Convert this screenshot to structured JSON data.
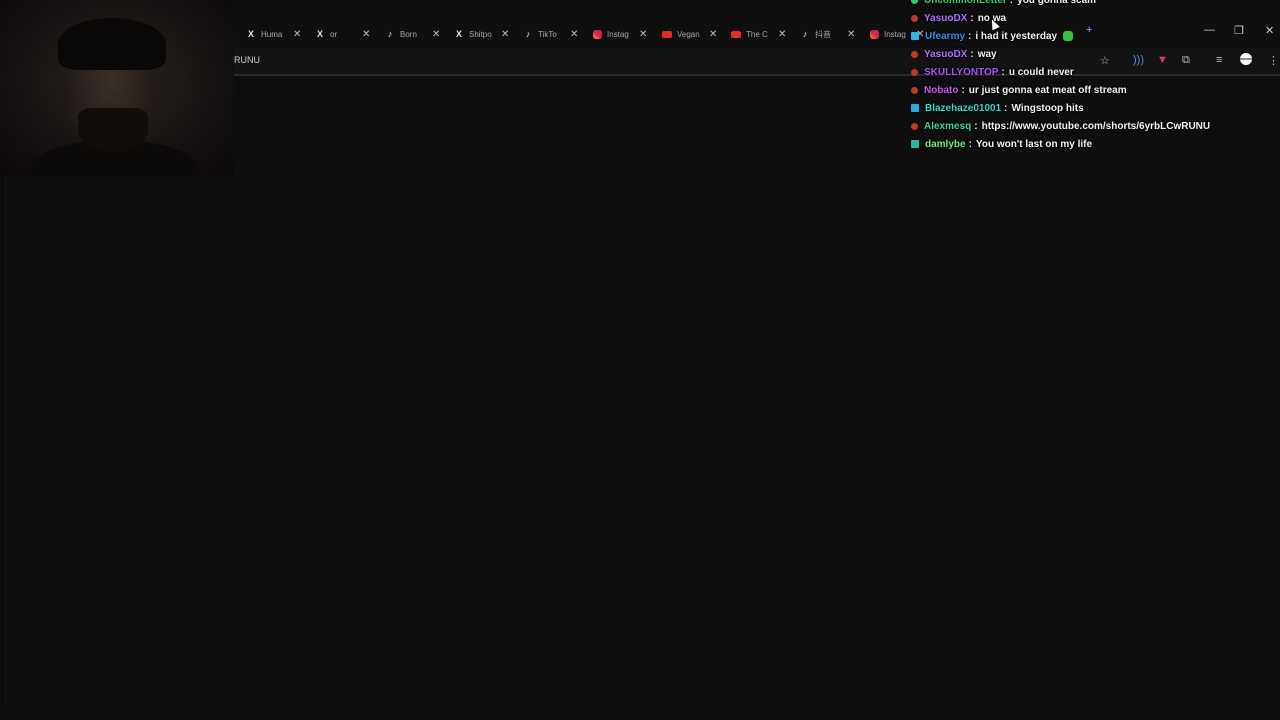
{
  "browser": {
    "tabs": [
      {
        "icon": "x-logo-icon",
        "label": "Huma"
      },
      {
        "icon": "x-logo-icon",
        "label": "or"
      },
      {
        "icon": "tiktok-icon",
        "label": "Born"
      },
      {
        "icon": "x-logo-icon",
        "label": "Shitpo"
      },
      {
        "icon": "tiktok-icon",
        "label": "TikTo"
      },
      {
        "icon": "instagram-icon",
        "label": "Instag"
      },
      {
        "icon": "youtube-icon",
        "label": "Vegan"
      },
      {
        "icon": "youtube-icon",
        "label": "The C"
      },
      {
        "icon": "tiktok-icon",
        "label": "抖音"
      },
      {
        "icon": "instagram-icon",
        "label": "Instag"
      }
    ],
    "new_tab_glyph": "+",
    "window_controls": {
      "minimize": "—",
      "restore": "❐",
      "close": "✕"
    },
    "address_text": "RUNU",
    "toolbar_icons": [
      "star-icon",
      "audio-icon",
      "extension-shield-icon",
      "puzzle-icon",
      "playlist-icon",
      "profile-icon",
      "kebab-menu-icon"
    ]
  },
  "chat": {
    "messages": [
      {
        "user": "UncommonLetter",
        "text": "you gonna scam",
        "user_color": "#3ecf7a",
        "badge_color": "#2ecc71",
        "badge_shape": "circle"
      },
      {
        "user": "YasuoDX",
        "text": "no wa",
        "user_color": "#b070ff",
        "badge_color": "#c0392b",
        "badge_shape": "circle"
      },
      {
        "user": "Ufearmy",
        "text": "i had it yesterday",
        "user_color": "#3a8ee6",
        "badge_color": "#2fb5e0",
        "badge_shape": "square",
        "emote": true
      },
      {
        "user": "YasuoDX",
        "text": "way",
        "user_color": "#b070ff",
        "badge_color": "#c0392b",
        "badge_shape": "circle"
      },
      {
        "user": "SKULLYONTOP",
        "text": "u could never",
        "user_color": "#a855f7",
        "badge_color": "#c0392b",
        "badge_shape": "circle"
      },
      {
        "user": "Nobato",
        "text": "ur just gonna eat meat off stream",
        "user_color": "#c45cf0",
        "badge_color": "#c0392b",
        "badge_shape": "circle"
      },
      {
        "user": "Blazehaze01001",
        "text": "Wingstoop hits",
        "user_color": "#3ad6c5",
        "badge_color": "#2fa8e0",
        "badge_shape": "square"
      },
      {
        "user": "Alexmesq",
        "text": "https://www.youtube.com/shorts/6yrbLCwRUNU",
        "user_color": "#3ad69a",
        "badge_color": "#c0392b",
        "badge_shape": "circle"
      },
      {
        "user": "damlybe",
        "text": "You won't last on my life",
        "user_color": "#6cf07a",
        "badge_color": "#2fb5a0",
        "badge_shape": "square"
      }
    ]
  }
}
